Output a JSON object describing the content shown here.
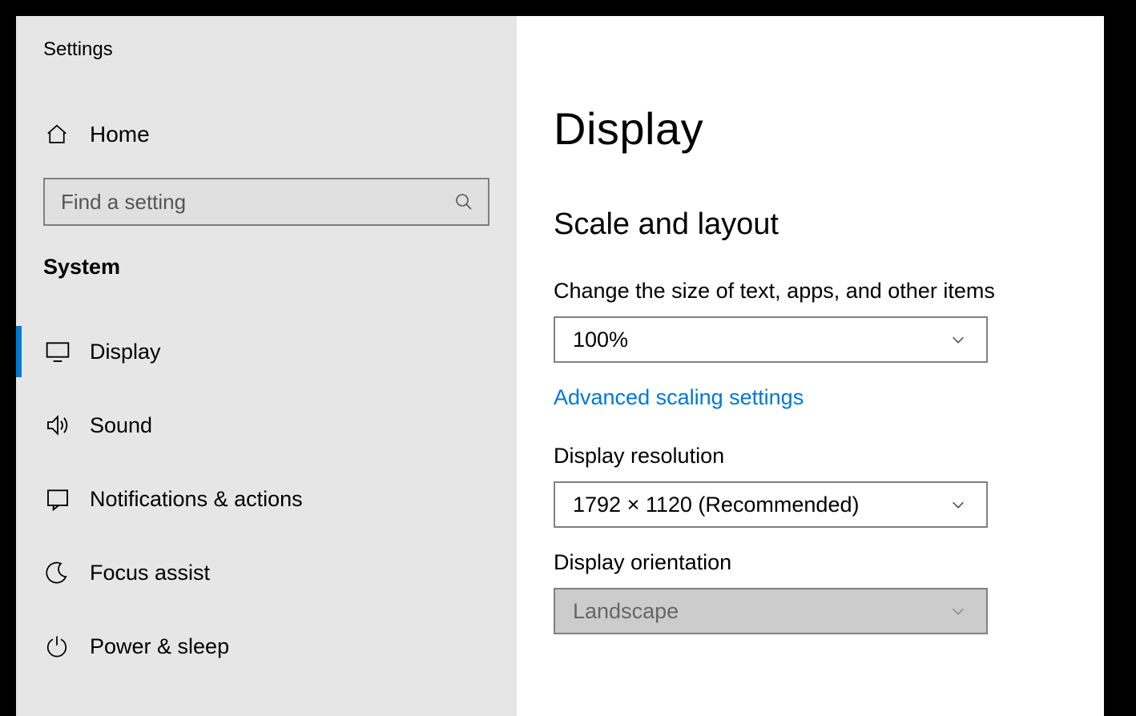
{
  "app_title": "Settings",
  "sidebar": {
    "home_label": "Home",
    "search_placeholder": "Find a setting",
    "category_label": "System",
    "items": [
      {
        "id": "display",
        "label": "Display",
        "icon": "monitor-icon",
        "active": true
      },
      {
        "id": "sound",
        "label": "Sound",
        "icon": "speaker-icon",
        "active": false
      },
      {
        "id": "notifications",
        "label": "Notifications & actions",
        "icon": "notification-icon",
        "active": false
      },
      {
        "id": "focus-assist",
        "label": "Focus assist",
        "icon": "moon-icon",
        "active": false
      },
      {
        "id": "power-sleep",
        "label": "Power & sleep",
        "icon": "power-icon",
        "active": false
      }
    ]
  },
  "main": {
    "page_title": "Display",
    "section_title": "Scale and layout",
    "scale_label": "Change the size of text, apps, and other items",
    "scale_value": "100%",
    "advanced_link": "Advanced scaling settings",
    "resolution_label": "Display resolution",
    "resolution_value": "1792 × 1120 (Recommended)",
    "orientation_label": "Display orientation",
    "orientation_value": "Landscape"
  }
}
